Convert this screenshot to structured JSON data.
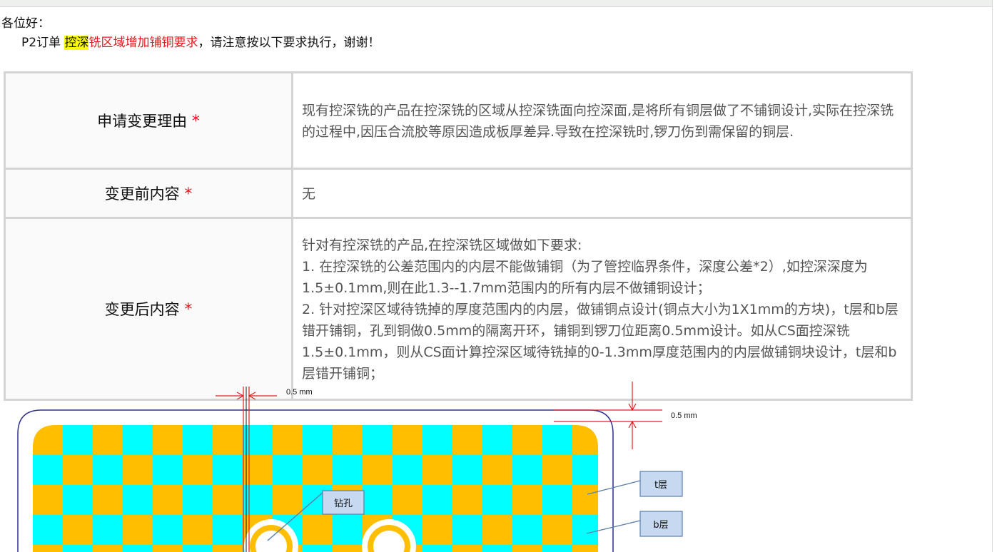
{
  "greeting": "各位好：",
  "notice": {
    "prefix": "P2订单 ",
    "highlight": "控深",
    "red": "铣区域增加铺铜要求",
    "suffix": "，请注意按以下要求执行，谢谢！"
  },
  "table": {
    "star": "*",
    "rows": [
      {
        "label": "申请变更理由",
        "content": "现有控深铣的产品在控深铣的区域从控深铣面向控深面,是将所有铜层做了不铺铜设计,实际在控深铣的过程中,因压合流胶等原因造成板厚差异.导致在控深铣时,锣刀伤到需保留的铜层."
      },
      {
        "label": "变更前内容",
        "content": "无"
      },
      {
        "label": "变更后内容",
        "content_lines": [
          "针对有控深铣的产品,在控深铣区域做如下要求:",
          "1. 在控深铣的公差范围内的内层不能做铺铜（为了管控临界条件，深度公差*2）,如控深深度为1.5±0.1mm,则在此1.3--1.7mm范围内的所有内层不做铺铜设计；",
          "2. 针对控深区域待铣掉的厚度范围内的内层，做铺铜点设计(铜点大小为1X1mm的方块)，t层和b层错开铺铜，孔到铜做0.5mm的隔离开环，铺铜到锣刀位距离0.5mm设计。如从CS面控深铣1.5±0.1mm，则从CS面计算控深区域待铣掉的0-1.3mm厚度范围内的内层做铺铜块设计，t层和b层错开铺铜；"
        ]
      }
    ]
  },
  "diagram": {
    "dim_left": "0.5 mm",
    "dim_right": "0.5 mm",
    "label_drill": "钻孔",
    "label_t": "t层",
    "label_b": "b层",
    "colors": {
      "orange": "#ffbf00",
      "cyan": "#00ffff",
      "outline": "#2e2e8f",
      "dimension": "#e02020",
      "callout_fill": "#c6d9f1",
      "callout_border": "#5b7fa8"
    }
  }
}
